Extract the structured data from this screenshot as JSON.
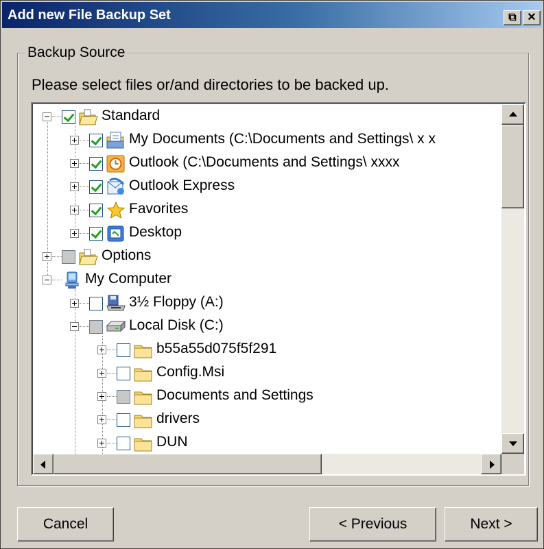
{
  "window": {
    "title": "Add new File Backup Set",
    "restore_glyph": "⧉",
    "close_glyph": "✕",
    "title_gradient": [
      "#0a246a",
      "#a6caf0"
    ],
    "face_color": "#d4d0c8"
  },
  "group": {
    "label": "Backup Source",
    "instruction": "Please select files or/and directories to be backed up."
  },
  "tree": {
    "rows": [
      {
        "label": "Standard",
        "expanded": true,
        "check": "checked",
        "icon": "folder-open-icon",
        "indent": 0
      },
      {
        "label": "My Documents (C:\\Documents and Settings\\ x x",
        "expanded": false,
        "check": "checked",
        "icon": "my-documents-icon",
        "indent": 1
      },
      {
        "label": "Outlook (C:\\Documents and Settings\\ xxxx",
        "expanded": false,
        "check": "checked",
        "icon": "outlook-icon",
        "indent": 1
      },
      {
        "label": "Outlook Express",
        "expanded": false,
        "check": "checked",
        "icon": "outlook-express-icon",
        "indent": 1
      },
      {
        "label": "Favorites",
        "expanded": false,
        "check": "checked",
        "icon": "favorites-star-icon",
        "indent": 1
      },
      {
        "label": "Desktop",
        "expanded": false,
        "check": "checked",
        "icon": "desktop-icon",
        "indent": 1
      },
      {
        "label": "Options",
        "expanded": false,
        "check": "partial",
        "icon": "folder-open-icon",
        "indent": 0
      },
      {
        "label": "My Computer",
        "expanded": true,
        "check": "none",
        "icon": "my-computer-icon",
        "indent": 0
      },
      {
        "label": "3½ Floppy (A:)",
        "expanded": false,
        "check": "unchecked",
        "icon": "floppy-drive-icon",
        "indent": 1
      },
      {
        "label": "Local Disk (C:)",
        "expanded": true,
        "check": "partial",
        "icon": "hard-disk-icon",
        "indent": 1
      },
      {
        "label": "b55a55d075f5f291",
        "expanded": false,
        "check": "unchecked",
        "icon": "folder-icon",
        "indent": 2
      },
      {
        "label": "Config.Msi",
        "expanded": false,
        "check": "unchecked",
        "icon": "folder-icon",
        "indent": 2
      },
      {
        "label": "Documents and Settings",
        "expanded": false,
        "check": "partial",
        "icon": "folder-icon",
        "indent": 2
      },
      {
        "label": "drivers",
        "expanded": false,
        "check": "unchecked",
        "icon": "folder-icon",
        "indent": 2
      },
      {
        "label": "DUN",
        "expanded": false,
        "check": "unchecked",
        "icon": "folder-icon",
        "indent": 2
      }
    ],
    "check_color": "#21a121"
  },
  "buttons": {
    "cancel": "Cancel",
    "previous": "< Previous",
    "next": "Next >"
  }
}
